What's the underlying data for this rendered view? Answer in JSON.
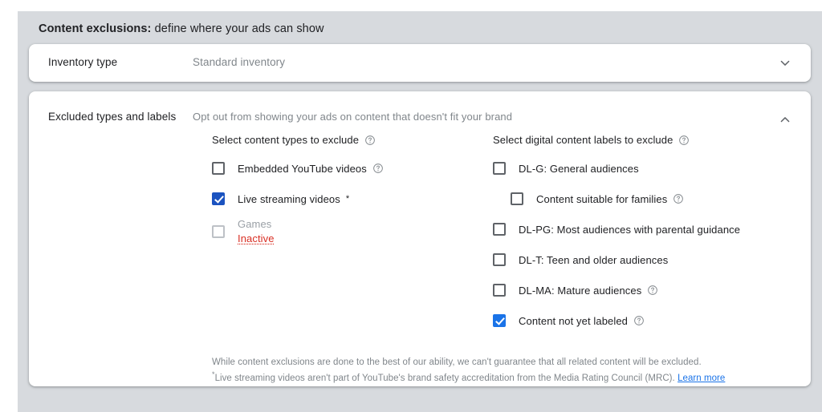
{
  "panel": {
    "title_bold": "Content exclusions:",
    "title_rest": " define where your ads can show"
  },
  "inventory_section": {
    "label": "Inventory type",
    "value": "Standard inventory",
    "toggle_icon": "chevron-down-icon"
  },
  "excluded_section": {
    "label": "Excluded types and labels",
    "description": "Opt out from showing your ads on content that doesn't fit your brand",
    "toggle_icon": "chevron-up-icon",
    "left_column": {
      "title": "Select content types to exclude",
      "title_help_icon": "help-icon",
      "items": [
        {
          "label": "Embedded YouTube videos",
          "checked": false,
          "disabled": false,
          "help_icon": "help-icon",
          "has_help": true,
          "star": false,
          "ripple": false
        },
        {
          "label": "Live streaming videos",
          "checked": true,
          "disabled": false,
          "has_help": false,
          "star": "*",
          "ripple": true
        },
        {
          "label": "Games",
          "status": "Inactive",
          "checked": false,
          "disabled": true,
          "has_help": false,
          "star": false,
          "ripple": false
        }
      ]
    },
    "right_column": {
      "title": "Select digital content labels to exclude",
      "title_help_icon": "help-icon",
      "items": [
        {
          "label": "DL-G: General audiences",
          "checked": false,
          "indent": false,
          "has_help": false
        },
        {
          "label": "Content suitable for families",
          "checked": false,
          "indent": true,
          "has_help": true,
          "help_icon": "help-icon"
        },
        {
          "label": "DL-PG: Most audiences with parental guidance",
          "checked": false,
          "indent": false,
          "has_help": false
        },
        {
          "label": "DL-T: Teen and older audiences",
          "checked": false,
          "indent": false,
          "has_help": false
        },
        {
          "label": "DL-MA: Mature audiences",
          "checked": false,
          "indent": false,
          "has_help": true,
          "help_icon": "help-icon"
        },
        {
          "label": "Content not yet labeled",
          "checked": true,
          "indent": false,
          "has_help": true,
          "help_icon": "help-icon"
        }
      ]
    },
    "footnote": {
      "line1": "While content exclusions are done to the best of our ability, we can't guarantee that all related content will be excluded.",
      "line2_star": "*",
      "line2": "Live streaming videos aren't part of YouTube's brand safety accreditation from the Media Rating Council (MRC). ",
      "link": "Learn more"
    }
  },
  "colors": {
    "accent": "#1a73e8",
    "accent_dark": "#1b53c0",
    "error": "#d93025",
    "panel_bg": "#d7dade",
    "text": "#202124",
    "muted": "#80868b"
  }
}
